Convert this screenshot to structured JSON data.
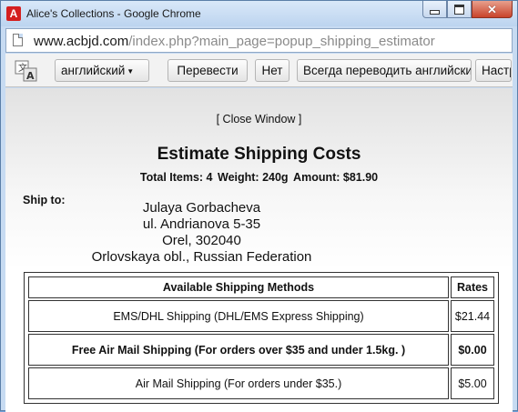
{
  "window": {
    "title": "Alice's Collections - Google Chrome",
    "app_icon": "A"
  },
  "address": {
    "host": "www.acbjd.com",
    "path": "/index.php?main_page=popup_shipping_estimator"
  },
  "translate_bar": {
    "language": "английский",
    "translate_label": "Перевести",
    "no_label": "Нет",
    "always_label": "Всегда переводить английский",
    "settings_label": "Настройки"
  },
  "page": {
    "close_window": "[ Close Window ]",
    "heading": "Estimate Shipping Costs",
    "summary": {
      "items": "Total Items: 4",
      "weight": "Weight: 240g",
      "amount": "Amount: $81.90"
    },
    "ship_to_label": "Ship to:",
    "address_lines": [
      "Julaya Gorbacheva",
      "ul. Andrianova 5-35",
      "Orel, 302040",
      "Orlovskaya obl., Russian Federation"
    ],
    "table": {
      "headers": [
        "Available Shipping Methods",
        "Rates"
      ],
      "rows": [
        {
          "method": "EMS/DHL Shipping (DHL/EMS Express Shipping)",
          "rate": "$21.44"
        },
        {
          "method": "Free Air Mail Shipping (For orders over $35 and under 1.5kg. )",
          "rate": "$0.00"
        },
        {
          "method": "Air Mail Shipping (For orders under $35.)",
          "rate": "$5.00"
        }
      ]
    }
  },
  "colors": {
    "title_bar": "#c7dbf2",
    "close_button": "#c9432b",
    "app_icon": "#d41f1f"
  }
}
